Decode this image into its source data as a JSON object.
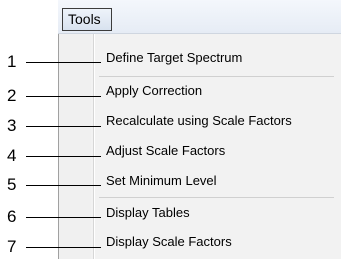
{
  "menubar": {
    "menu_label": "Tools"
  },
  "menu": {
    "items": [
      {
        "label": "Define Target Spectrum"
      },
      {
        "label": "Apply Correction"
      },
      {
        "label": "Recalculate using Scale Factors"
      },
      {
        "label": "Adjust Scale Factors"
      },
      {
        "label": "Set Minimum Level"
      },
      {
        "label": "Display Tables"
      },
      {
        "label": "Display Scale Factors"
      }
    ]
  },
  "callouts": [
    "1",
    "2",
    "3",
    "4",
    "5",
    "6",
    "7"
  ]
}
